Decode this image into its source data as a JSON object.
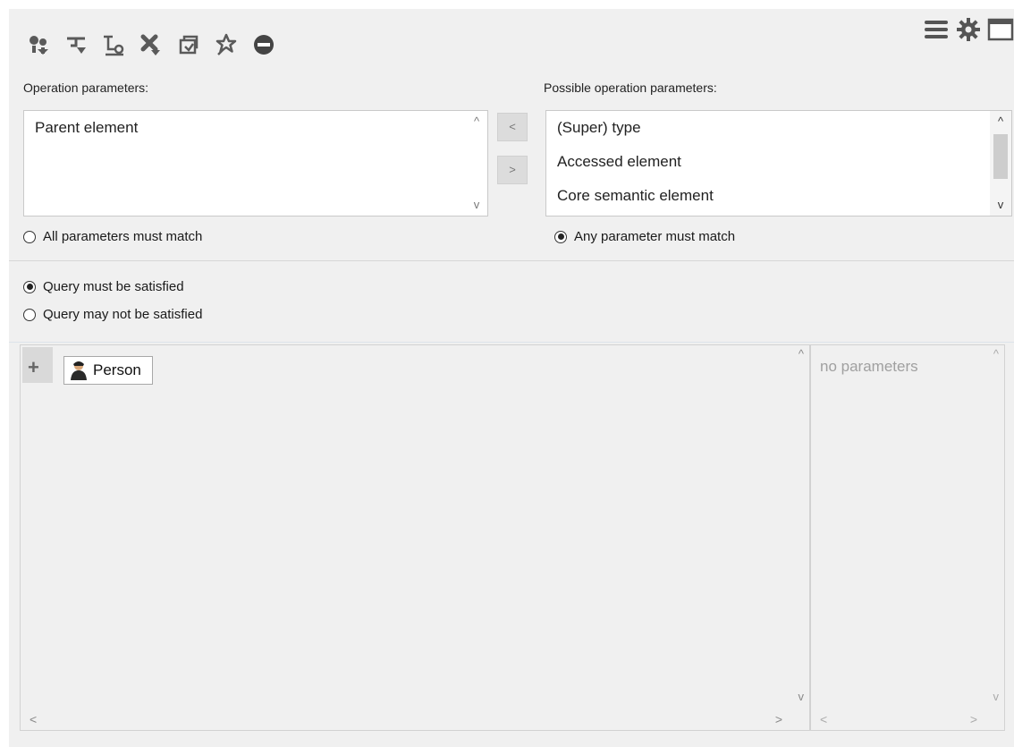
{
  "toolbar": {
    "left_icons": [
      "add-operation-icon",
      "filter-icon",
      "relation-icon",
      "remove-operation-icon",
      "copy-icon",
      "pin-icon",
      "minus-circle-icon"
    ],
    "right_icons": [
      "menu-icon",
      "settings-icon",
      "window-icon"
    ]
  },
  "operation_parameters": {
    "label": "Operation parameters:",
    "items": [
      "Parent element"
    ]
  },
  "possible_parameters": {
    "label": "Possible operation parameters:",
    "items": [
      "(Super) type",
      "Accessed element",
      "Core semantic element"
    ]
  },
  "move_buttons": {
    "left": "<",
    "right": ">"
  },
  "match_options": {
    "all": "All parameters must match",
    "any": "Any parameter must match",
    "selected": "any"
  },
  "query_options": {
    "satisfied": "Query must be satisfied",
    "not_satisfied": "Query may not be satisfied",
    "selected": "satisfied"
  },
  "tree": {
    "expand_symbol": "+",
    "node_label": "Person",
    "node_icon": "person-icon"
  },
  "parameters_panel": {
    "empty_text": "no parameters"
  },
  "scroll": {
    "up": "^",
    "down": "v",
    "left": "<",
    "right": ">"
  },
  "colors": {
    "icon": "#555555",
    "background": "#f0f0f0"
  }
}
